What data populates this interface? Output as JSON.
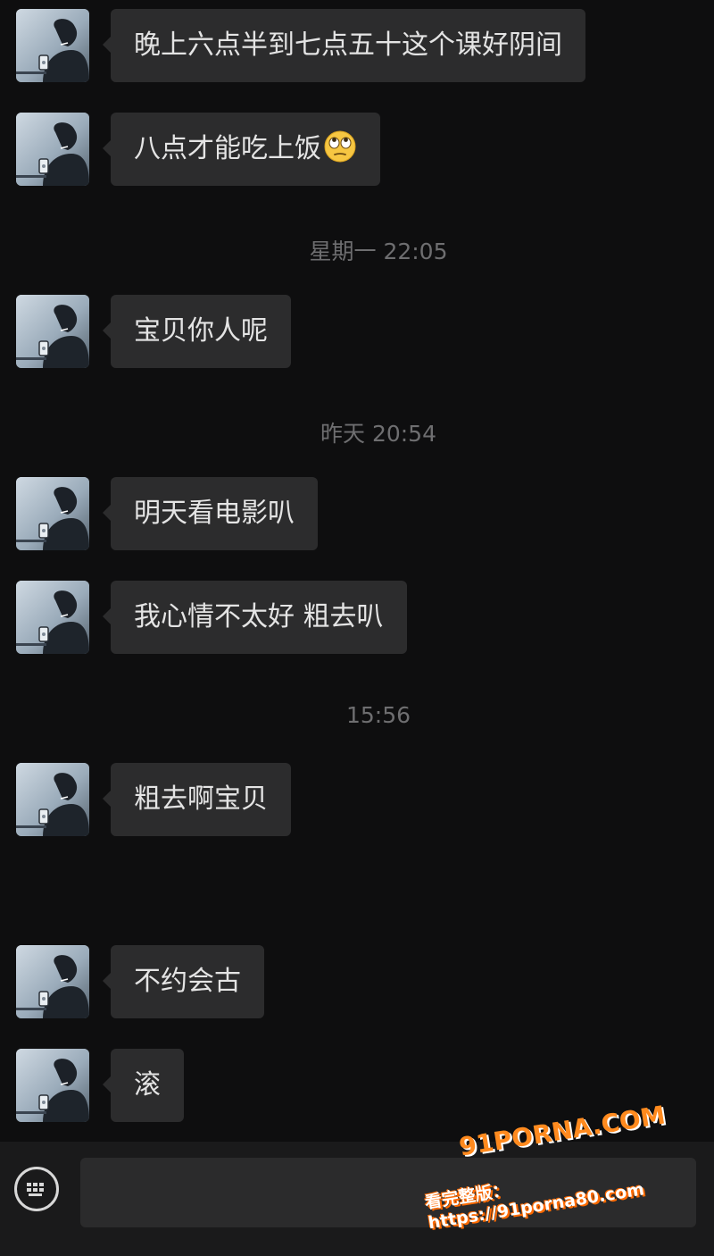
{
  "messages": [
    {
      "text": "晚上六点半到七点五十这个课好阴间",
      "emoji": ""
    },
    {
      "text": "八点才能吃上饭",
      "emoji": "eye-roll"
    },
    {
      "text": "宝贝你人呢",
      "emoji": ""
    },
    {
      "text": "明天看电影叭",
      "emoji": ""
    },
    {
      "text": "我心情不太好 粗去叭",
      "emoji": ""
    },
    {
      "text": "粗去啊宝贝",
      "emoji": ""
    },
    {
      "text": "不约会古",
      "emoji": ""
    },
    {
      "text": "滚",
      "emoji": ""
    }
  ],
  "timestamps": [
    "星期一 22:05",
    "昨天 20:54",
    "15:56"
  ],
  "input_bar": {
    "keyboard_icon": "keyboard-icon",
    "input_value": ""
  },
  "watermark": {
    "line1": "91PORNA.COM",
    "line2": "看完整版：https://91porna80.com"
  },
  "colors": {
    "background": "#0e0e0f",
    "bubble": "#2c2c2d",
    "text": "#e4e4e4",
    "timestamp": "#6e6e70",
    "watermark_orange": "#ff8a1e"
  }
}
